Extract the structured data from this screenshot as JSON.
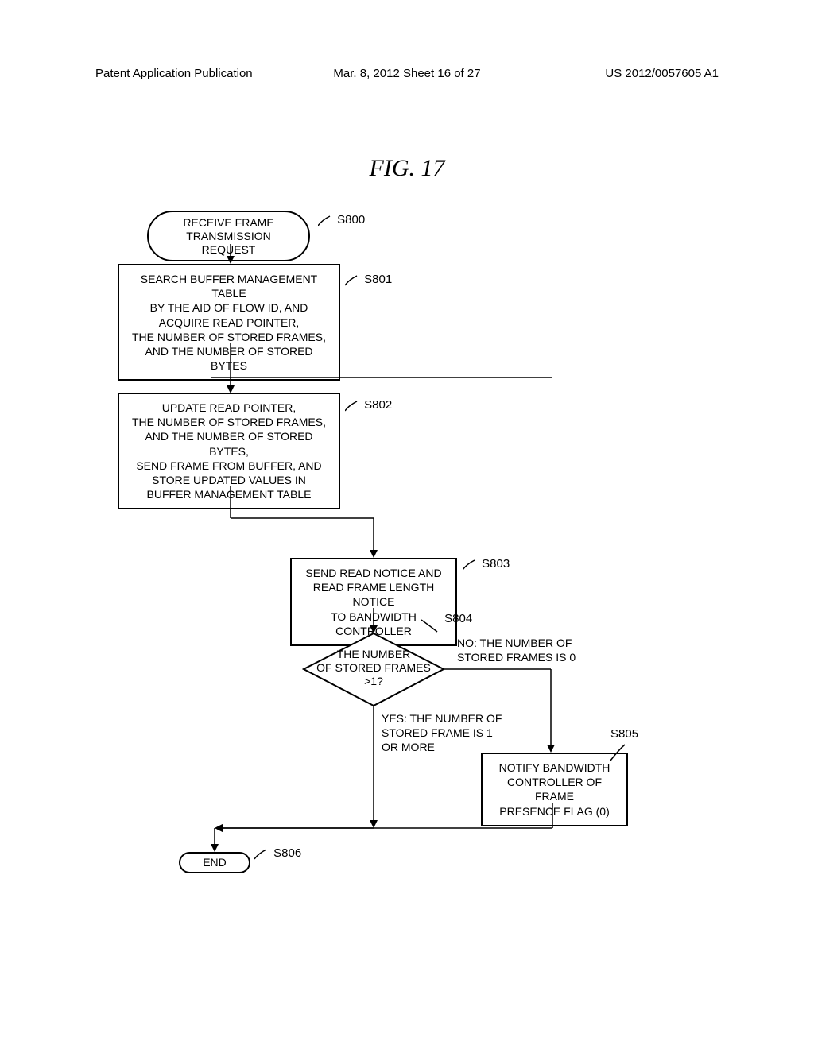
{
  "header": {
    "left": "Patent Application Publication",
    "center": "Mar. 8, 2012  Sheet 16 of 27",
    "right": "US 2012/0057605 A1"
  },
  "figure_title": "FIG.  17",
  "steps": {
    "s800": {
      "label": "S800",
      "text": "RECEIVE FRAME\nTRANSMISSION REQUEST"
    },
    "s801": {
      "label": "S801",
      "text": "SEARCH BUFFER MANAGEMENT TABLE\nBY THE AID OF FLOW ID, AND\nACQUIRE READ POINTER,\nTHE NUMBER OF STORED FRAMES,\nAND THE NUMBER OF STORED BYTES"
    },
    "s802": {
      "label": "S802",
      "text": "UPDATE READ POINTER,\nTHE NUMBER OF STORED FRAMES,\nAND THE NUMBER OF STORED BYTES,\nSEND FRAME FROM BUFFER, AND\nSTORE UPDATED VALUES IN\nBUFFER MANAGEMENT TABLE"
    },
    "s803": {
      "label": "S803",
      "text": "SEND READ NOTICE AND\nREAD FRAME LENGTH NOTICE\nTO BANDWIDTH CONTROLLER"
    },
    "s804": {
      "label": "S804",
      "text": "THE NUMBER\nOF STORED FRAMES\n>1?"
    },
    "s804_no": "NO: THE NUMBER OF\nSTORED FRAMES IS 0",
    "s804_yes": "YES: THE NUMBER OF\nSTORED FRAME IS 1\nOR MORE",
    "s805": {
      "label": "S805",
      "text": "NOTIFY BANDWIDTH\nCONTROLLER OF FRAME\nPRESENCE FLAG (0)"
    },
    "s806": {
      "label": "S806",
      "text": "END"
    }
  }
}
